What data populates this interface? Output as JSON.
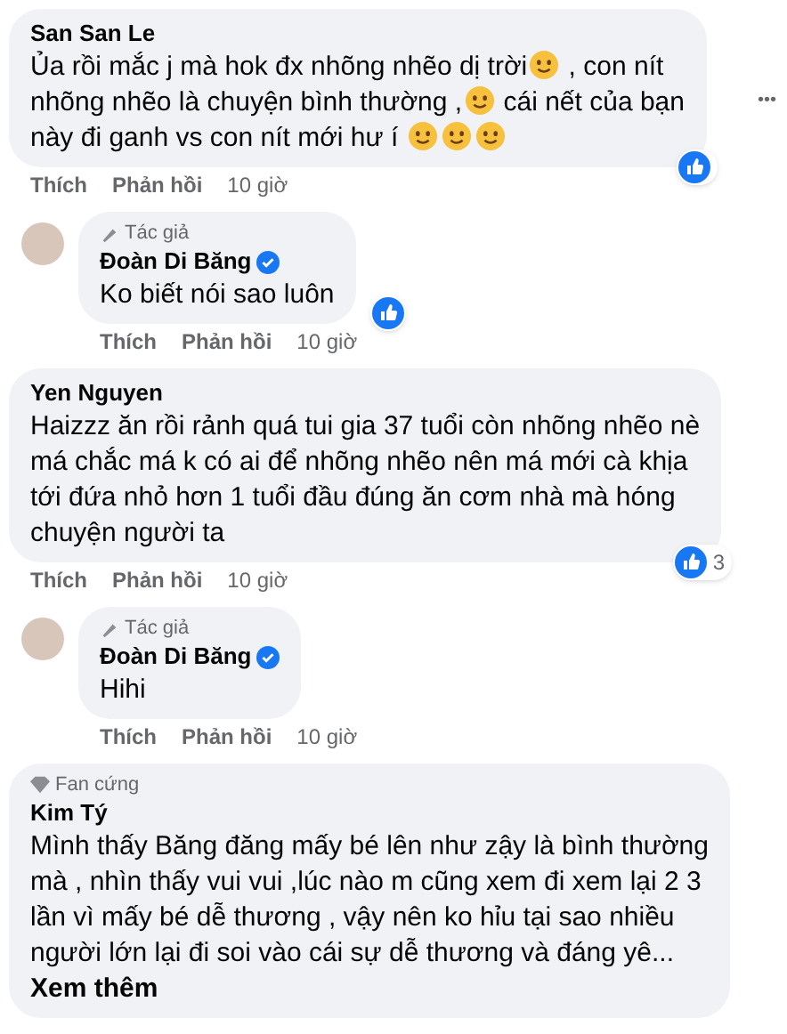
{
  "comments": [
    {
      "author": "San San Le",
      "reply": false,
      "lines": [
        [
          {
            "kind": "text",
            "text": "Ủa rồi mắc j mà hok đx nhõng nhẽo dị trời"
          },
          {
            "kind": "emoji"
          },
          {
            "kind": "text",
            "text": " , con nít"
          }
        ],
        [
          {
            "kind": "text",
            "text": "nhõng nhẽo là chuyện bình thường ,"
          },
          {
            "kind": "emoji"
          },
          {
            "kind": "text",
            "text": " cái nết của bạn"
          }
        ],
        [
          {
            "kind": "text",
            "text": "này đi ganh vs con nít mới hư í "
          },
          {
            "kind": "emoji"
          },
          {
            "kind": "emoji"
          },
          {
            "kind": "emoji"
          }
        ]
      ],
      "reacted": true,
      "menu": "•••",
      "actions": {
        "like": "Thích",
        "reply": "Phản hồi",
        "time": "10 giờ"
      }
    },
    {
      "badge": {
        "kind": "author",
        "text": "Tác giả"
      },
      "author": "Đoàn Di Băng",
      "verified": true,
      "reply": true,
      "lines": [
        [
          {
            "kind": "text",
            "text": "Ko biết nói sao luôn"
          }
        ]
      ],
      "reacted": true,
      "actions": {
        "like": "Thích",
        "reply": "Phản hồi",
        "time": "10 giờ"
      }
    },
    {
      "author": "Yen Nguyen",
      "reply": false,
      "lines": [
        [
          {
            "kind": "text",
            "text": "Haizzz ăn rồi rảnh quá tui gia 37 tuổi còn nhõng nhẽo nè"
          }
        ],
        [
          {
            "kind": "text",
            "text": "má chắc má k có ai để nhõng nhẽo nên má mới cà khịa"
          }
        ],
        [
          {
            "kind": "text",
            "text": "tới đứa nhỏ hơn 1 tuổi đầu đúng ăn cơm nhà mà hóng"
          }
        ],
        [
          {
            "kind": "text",
            "text": "chuyện người ta"
          }
        ]
      ],
      "reacted": true,
      "reactions": "3",
      "actions": {
        "like": "Thích",
        "reply": "Phản hồi",
        "time": "10 giờ"
      }
    },
    {
      "badge": {
        "kind": "author",
        "text": "Tác giả"
      },
      "author": "Đoàn Di Băng",
      "verified": true,
      "reply": true,
      "lines": [
        [
          {
            "kind": "text",
            "text": "Hihi"
          }
        ]
      ],
      "reacted": false,
      "actions": {
        "like": "Thích",
        "reply": "Phản hồi",
        "time": "10 giờ"
      }
    },
    {
      "badge": {
        "kind": "fan",
        "text": "Fan cứng"
      },
      "author": "Kim Tý",
      "reply": false,
      "lines": [
        [
          {
            "kind": "text",
            "text": "Mình thấy Băng đăng mấy bé lên như zậy là bình thường"
          }
        ],
        [
          {
            "kind": "text",
            "text": "mà , nhìn thấy vui vui ,lúc nào m cũng xem đi xem lại 2 3"
          }
        ],
        [
          {
            "kind": "text",
            "text": "lần vì mấy bé dễ thương , vậy nên ko hỉu tại sao nhiều"
          }
        ],
        [
          {
            "kind": "text",
            "text": "người lớn lại đi soi vào cái sự dễ thương và đáng yê..."
          }
        ]
      ],
      "more": "Xem thêm",
      "reacted": false
    }
  ]
}
